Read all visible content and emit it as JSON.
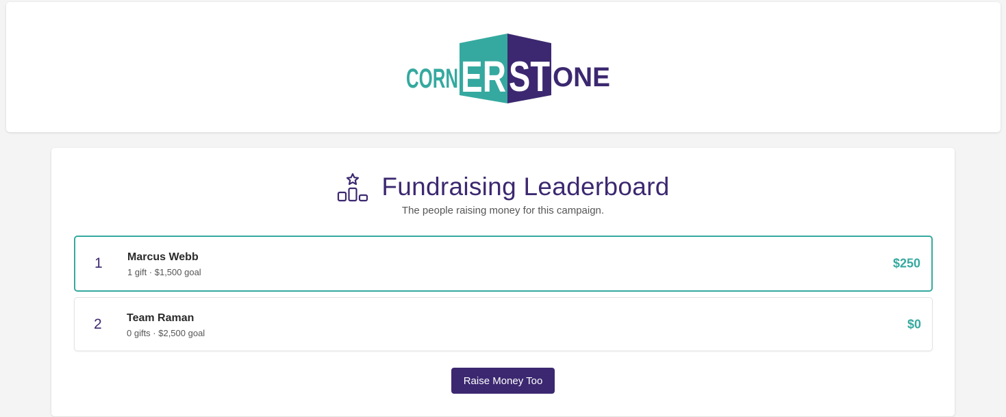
{
  "brand": {
    "logo_text": "CORNERSTONE",
    "logo_parts": [
      "CORN",
      "ER",
      "ST",
      "ONE"
    ],
    "teal": "#35a99f",
    "purple": "#3c2870"
  },
  "leaderboard": {
    "icon": "podium-star-icon",
    "title": "Fundraising Leaderboard",
    "subtitle": "The people raising money for this campaign.",
    "entries": [
      {
        "rank": "1",
        "name": "Marcus Webb",
        "meta": "1 gift · $1,500 goal",
        "amount": "$250"
      },
      {
        "rank": "2",
        "name": "Team Raman",
        "meta": "0 gifts · $2,500 goal",
        "amount": "$0"
      }
    ],
    "cta_label": "Raise Money Too"
  }
}
